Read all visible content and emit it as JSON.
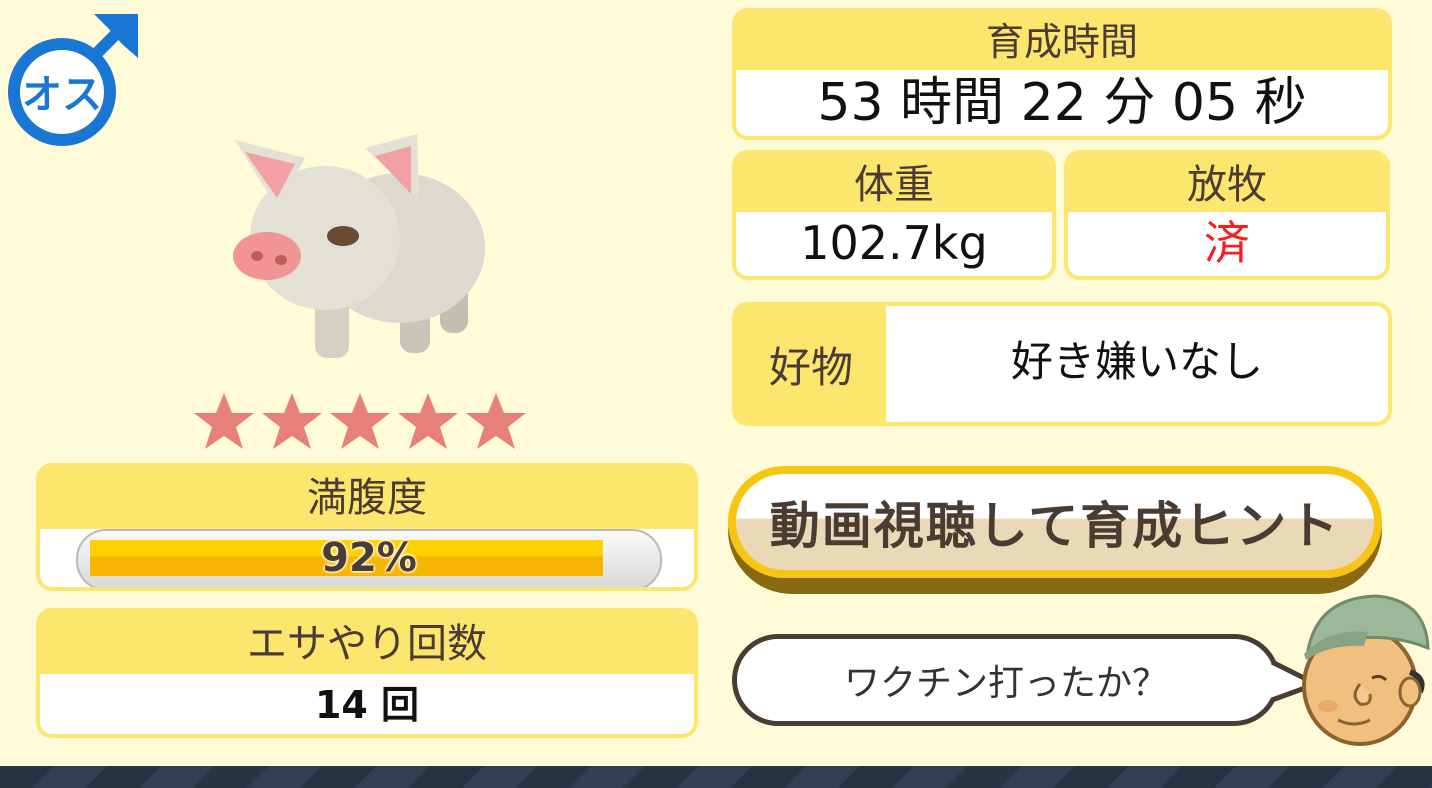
{
  "gender": {
    "label": "オス",
    "symbol": "male",
    "color": "#1976d2"
  },
  "pig": {
    "rating_stars": 5,
    "star_color": "#e8807a"
  },
  "satiety": {
    "title": "満腹度",
    "value_text": "92%",
    "value": 92
  },
  "feed_count": {
    "title": "エサやり回数",
    "value": "14 回"
  },
  "breeding_time": {
    "title": "育成時間",
    "value": "53 時間 22 分 05 秒"
  },
  "weight": {
    "title": "体重",
    "value": "102.7kg"
  },
  "grazing": {
    "title": "放牧",
    "value": "済",
    "value_color": "#ff1a1a"
  },
  "favorite": {
    "title": "好物",
    "value": "好き嫌いなし"
  },
  "hint_button": {
    "label": "動画視聴して育成ヒント"
  },
  "speech": {
    "text": "ワクチン打ったか？"
  },
  "colors": {
    "background": "#fffbd9",
    "card_header": "#fde66e",
    "text_brown": "#4b3c33",
    "accent_yellow": "#f7c514"
  }
}
